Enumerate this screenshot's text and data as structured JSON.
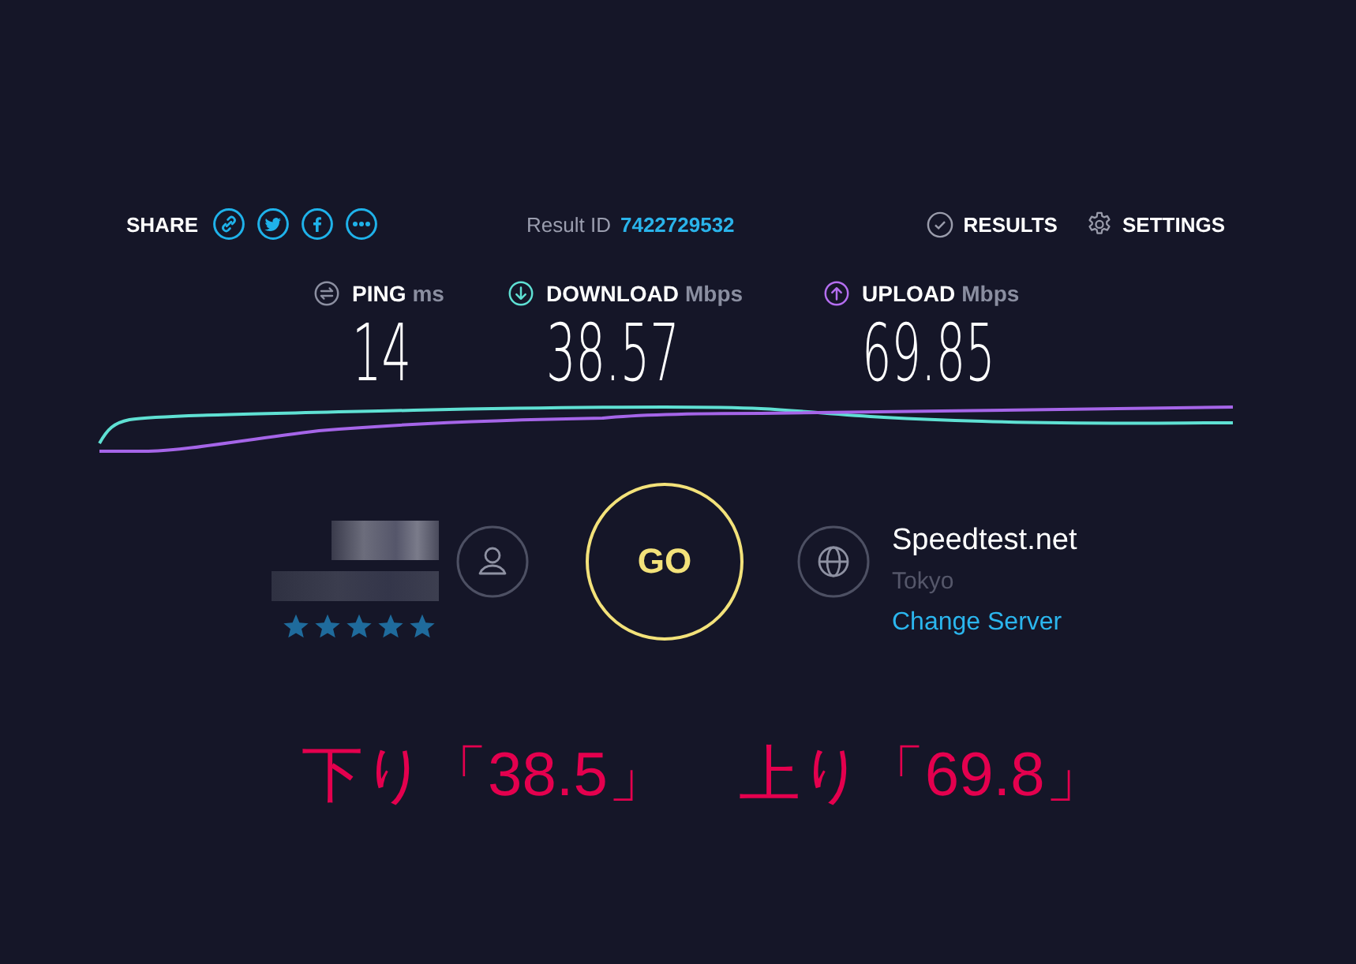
{
  "share": {
    "label": "SHARE"
  },
  "result": {
    "label": "Result ID",
    "id": "7422729532"
  },
  "results_link": {
    "label": "RESULTS"
  },
  "settings_link": {
    "label": "SETTINGS"
  },
  "metrics": [
    {
      "kind": "ping",
      "label": "PING",
      "unit": "ms",
      "value": "14"
    },
    {
      "kind": "download",
      "label": "DOWNLOAD",
      "unit": "Mbps",
      "value": "38.57"
    },
    {
      "kind": "upload",
      "label": "UPLOAD",
      "unit": "Mbps",
      "value": "69.85"
    }
  ],
  "isp": {
    "stars": 5
  },
  "go_button": {
    "label": "GO"
  },
  "server": {
    "name": "Speedtest.net",
    "location": "Tokyo",
    "link": "Change Server"
  },
  "annotations": [
    "下り「38.5」",
    "上り「69.8」"
  ]
}
